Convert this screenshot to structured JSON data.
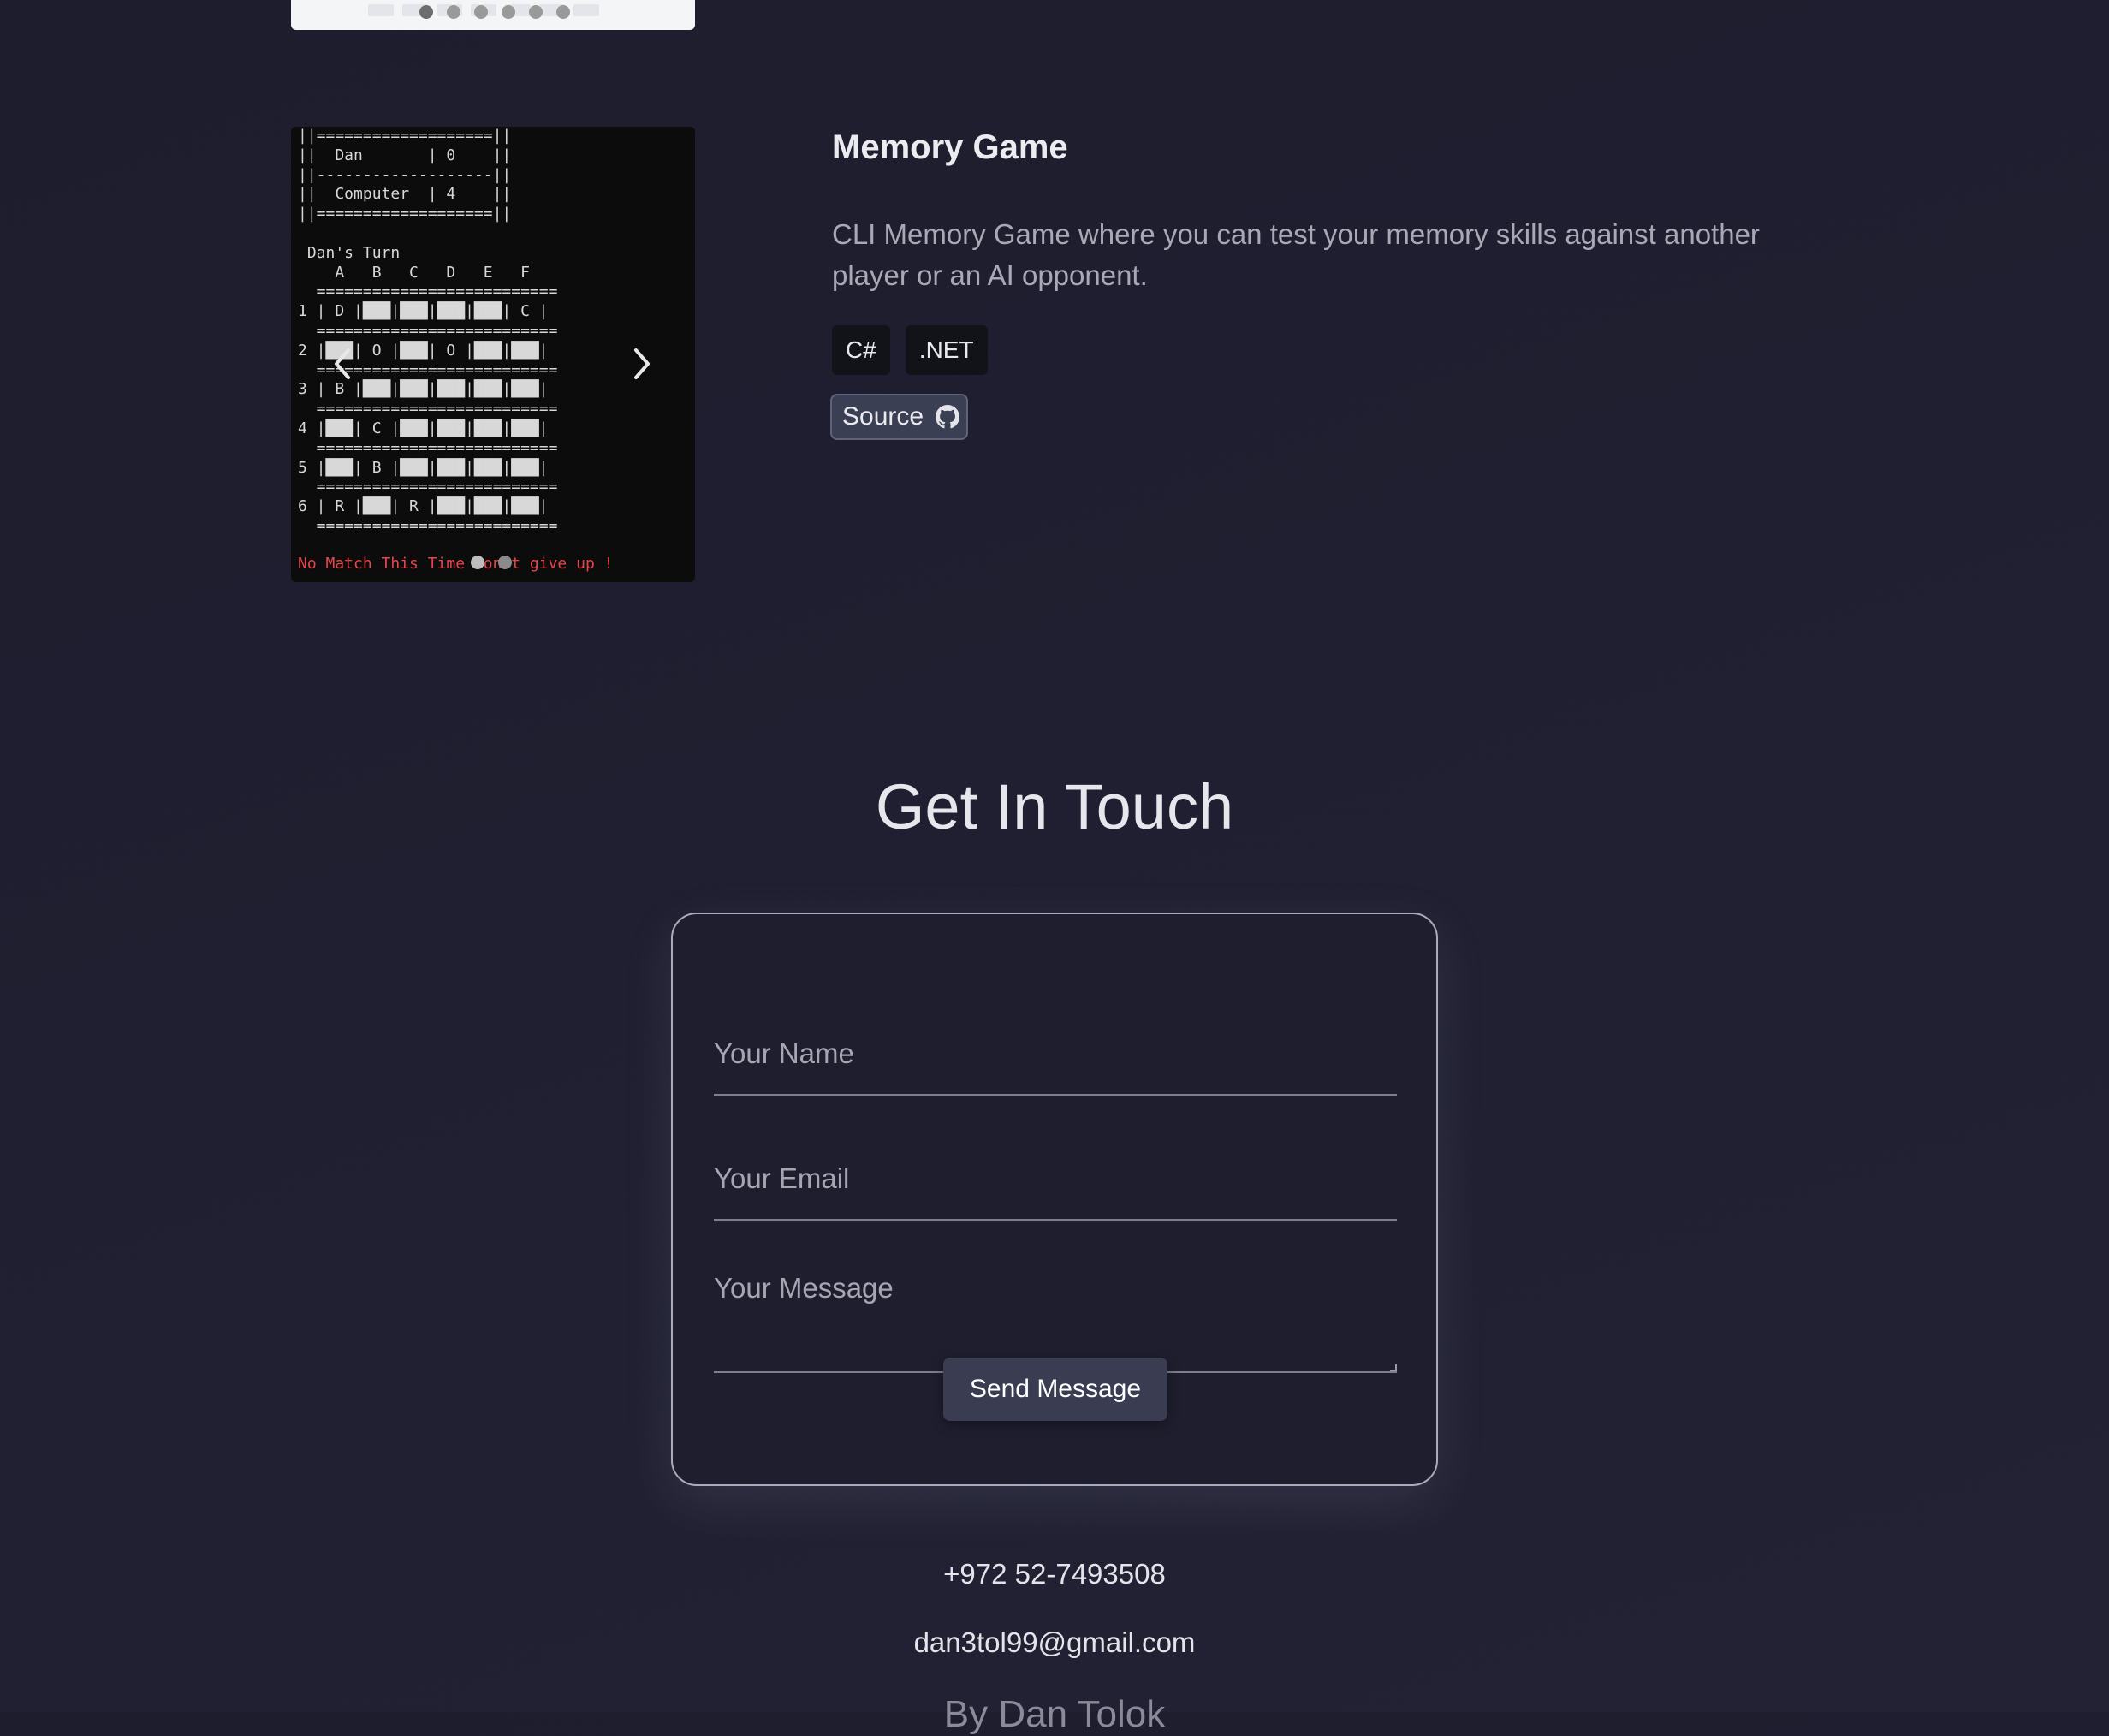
{
  "project": {
    "title": "Memory Game",
    "description": "CLI Memory Game where you can test your memory skills against another player or an AI opponent.",
    "tags": [
      "C#",
      ".NET"
    ],
    "source_label": "Source",
    "image": {
      "terminal_text": "||===================||\n||  Dan       | 0    ||\n||-------------------||\n||  Computer  | 4    ||\n||===================||\n\n Dan's Turn\n    A   B   C   D   E   F\n  ==========================\n1 | D |███|███|███|███| C |\n  ==========================\n2 |███| O |███| O |███|███|\n  ==========================\n3 | B |███|███|███|███|███|\n  ==========================\n4 |███| C |███|███|███|███|\n  ==========================\n5 |███| B |███|███|███|███|\n  ==========================\n6 | R |███| R |███|███|███|\n  ==========================",
      "message": "No Match This Time Don't give up !"
    },
    "carousel": {
      "prev_icon": "chevron-left-icon",
      "next_icon": "chevron-right-icon"
    }
  },
  "contact": {
    "title": "Get In Touch",
    "name_placeholder": "Your Name",
    "email_placeholder": "Your Email",
    "message_placeholder": "Your Message",
    "send_label": "Send Message",
    "phone": "+972 52-7493508",
    "email": "dan3tol99@gmail.com"
  },
  "footer": {
    "text": "By Dan Tolok"
  },
  "colors": {
    "background": "#1e1e2e",
    "terminal_message": "#e8454b",
    "button": "#3a3d52",
    "tag_background": "#121219"
  }
}
